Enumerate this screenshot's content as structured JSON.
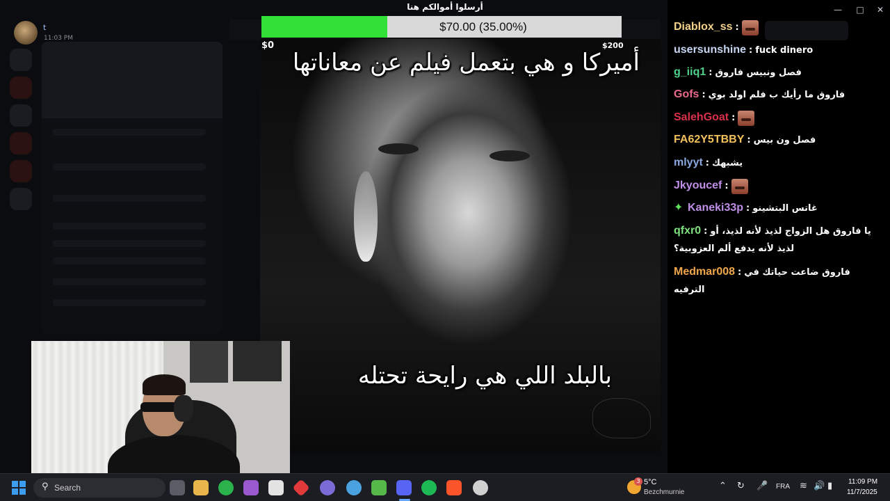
{
  "window": {
    "profile_name": "t",
    "profile_time": "11:03 PM"
  },
  "donation_goal": {
    "title": "أرسلوا أموالكم هنا",
    "progress_text": "$70.00 (35.00%)",
    "progress_fraction": 0.35,
    "min_label": "$0",
    "max_label": "$200",
    "fill_color": "#32e036"
  },
  "meme": {
    "caption_top": "أميركا و هي بتعمل فيلم عن معاناتها",
    "caption_bottom": "بالبلد اللي هي رايحة تحتله"
  },
  "chat": {
    "messages": [
      {
        "user": "Diablox_ss",
        "color": "#f3d38a",
        "text": "",
        "emote": true
      },
      {
        "user": "usersunshine",
        "color": "#c6d5f0",
        "text": "fuck dinero",
        "emote": false
      },
      {
        "user": "g_iiq1",
        "color": "#4fd18b",
        "text": "فصل ونبيس فاروق",
        "emote": false
      },
      {
        "user": "Gofs",
        "color": "#e86a8b",
        "text": "فاروق ما رأيك ب فلم اولد بوي",
        "emote": false
      },
      {
        "user": "SalehGoat",
        "color": "#d9304a",
        "text": "",
        "emote": true
      },
      {
        "user": "FA62Y5TBBY",
        "color": "#f3c15b",
        "text": "فصل ون بيس",
        "emote": false
      },
      {
        "user": "mlyyt",
        "color": "#8aa8e0",
        "text": "يشبهك",
        "emote": false
      },
      {
        "user": "Jkyoucef",
        "color": "#c08fe8",
        "text": "",
        "emote": true
      },
      {
        "user": "Kaneki33p",
        "color": "#c08fe8",
        "text": "غاتس البتشينو",
        "emote": false,
        "badge": true
      },
      {
        "user": "qfxr0",
        "color": "#7ee07e",
        "text": "يا فاروق هل الزواج لذيذ لأنه لذيذ، أو",
        "text2": "لذيذ لأنه يدفع ألم العزوبية؟",
        "emote": false
      },
      {
        "user": "Medmar008",
        "color": "#f0a64a",
        "text": "فاروق ضاعت حياتك في",
        "text2": "الترفيه",
        "emote": false
      }
    ]
  },
  "taskbar": {
    "search_placeholder": "Search",
    "weather_temp": "5°C",
    "weather_location": "Bezchmurnie",
    "weather_badge": "3",
    "language": "FRA",
    "time": "11:09 PM",
    "date": "11/7/2025"
  },
  "icons": [
    "start-icon",
    "search-icon",
    "discord-icon",
    "spotify-icon",
    "brave-icon",
    "wifi-icon",
    "volume-icon",
    "battery-icon",
    "mic-icon"
  ]
}
